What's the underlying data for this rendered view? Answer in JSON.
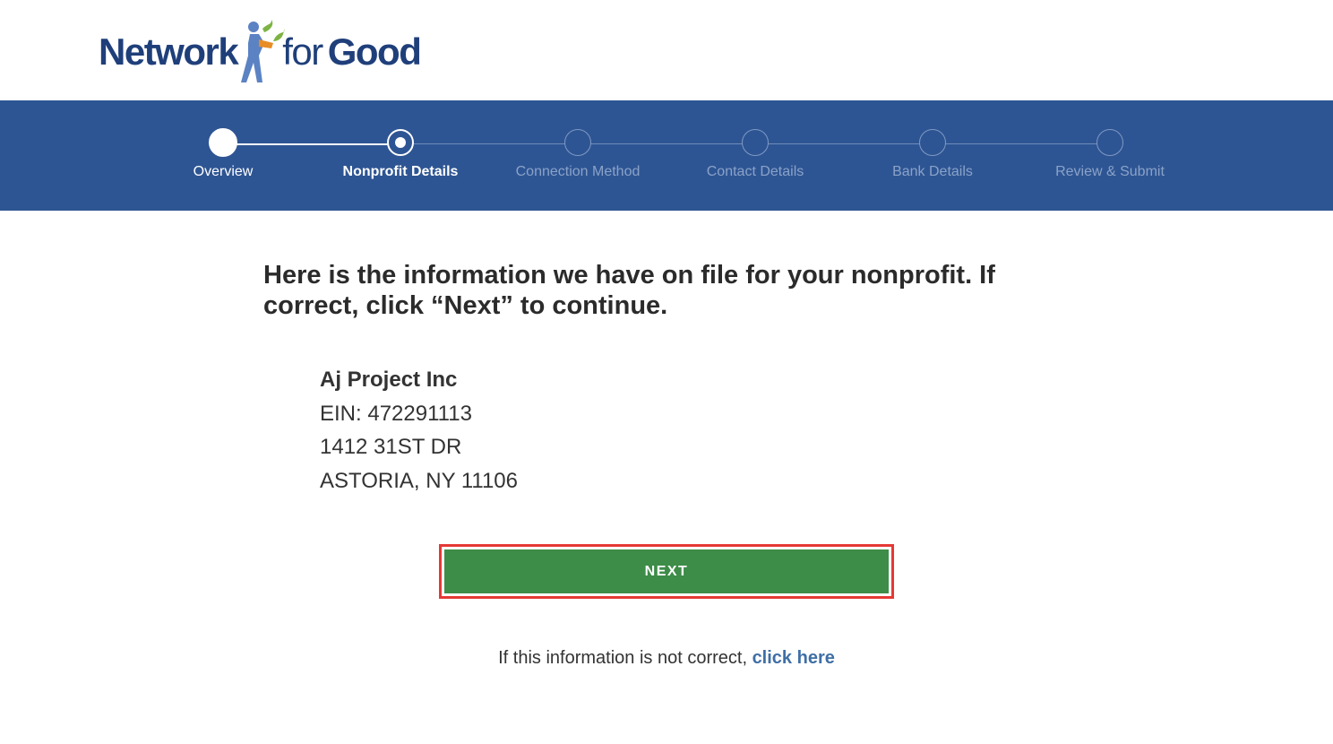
{
  "brand": {
    "word_1": "Network",
    "word_2": "for",
    "word_3": "Good",
    "colors": {
      "navy": "#1f3f7a",
      "figure_blue": "#5b82c3",
      "figure_green": "#7db343",
      "figure_orange": "#e88c25"
    }
  },
  "stepper": {
    "background": "#2e5593",
    "steps": [
      {
        "label": "Overview",
        "state": "done"
      },
      {
        "label": "Nonprofit Details",
        "state": "current"
      },
      {
        "label": "Connection Method",
        "state": "upcoming"
      },
      {
        "label": "Contact Details",
        "state": "upcoming"
      },
      {
        "label": "Bank Details",
        "state": "upcoming"
      },
      {
        "label": "Review & Submit",
        "state": "upcoming"
      }
    ]
  },
  "main": {
    "headline": "Here is the information we have on file for your nonprofit. If correct, click “Next” to continue.",
    "org": {
      "name": "Aj Project Inc",
      "ein": "EIN: 472291113",
      "address_line_1": "1412 31ST DR",
      "address_line_2": "ASTORIA, NY 11106"
    },
    "next_label": "NEXT",
    "next_color": "#3d8c48",
    "highlight_color": "#e53935",
    "footer_text": "If this information is not correct, ",
    "footer_link": "click here"
  }
}
